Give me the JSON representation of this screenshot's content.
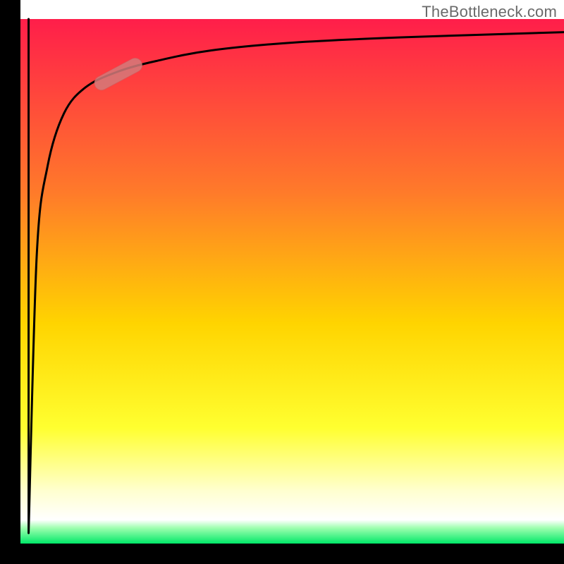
{
  "watermark": "TheBottleneck.com",
  "colors": {
    "axis": "#000000",
    "grad_top": "#ff1e4a",
    "grad_upper_mid": "#ff6a2a",
    "grad_mid": "#ffd200",
    "grad_lower_mid": "#ffff40",
    "grad_yellow_pale": "#ffffcc",
    "grad_bottom": "#00f070",
    "curve": "#000000",
    "marker_fill": "#d47a7a",
    "marker_stroke": "#c86868"
  },
  "chart_data": {
    "type": "line",
    "title": "",
    "xlabel": "",
    "ylabel": "",
    "xlim": [
      0,
      100
    ],
    "ylim": [
      0,
      100
    ],
    "gradient_bands": [
      {
        "y": 100,
        "color": "red"
      },
      {
        "y": 50,
        "color": "orange"
      },
      {
        "y": 25,
        "color": "yellow"
      },
      {
        "y": 5,
        "color": "pale-yellow-white"
      },
      {
        "y": 0,
        "color": "green"
      }
    ],
    "series": [
      {
        "name": "vertical-drop",
        "x": [
          1.5,
          1.5
        ],
        "values": [
          100,
          2
        ]
      },
      {
        "name": "saturating-curve",
        "x": [
          1.5,
          3,
          5,
          8,
          12,
          18,
          25,
          35,
          50,
          70,
          100
        ],
        "values": [
          2,
          55,
          72,
          82,
          87,
          90,
          92,
          94,
          95.5,
          96.5,
          97.5
        ]
      }
    ],
    "marker": {
      "x_center": 18,
      "y_center": 89.5,
      "length_pct": 6,
      "angle_deg": -28,
      "shape": "rounded-pill"
    },
    "annotations": []
  }
}
